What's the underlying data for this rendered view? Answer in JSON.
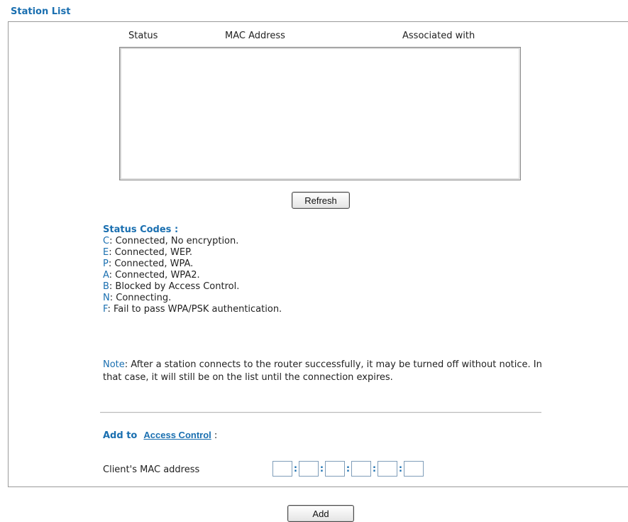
{
  "title": "Station List",
  "table": {
    "headers": [
      "Status",
      "MAC Address",
      "Associated with"
    ],
    "rows": []
  },
  "refresh_label": "Refresh",
  "status_codes": {
    "title": "Status Codes :",
    "items": [
      {
        "code": "C",
        "text": ": Connected, No encryption."
      },
      {
        "code": "E",
        "text": ": Connected, WEP."
      },
      {
        "code": "P",
        "text": ": Connected, WPA."
      },
      {
        "code": "A",
        "text": ": Connected, WPA2."
      },
      {
        "code": "B",
        "text": ": Blocked by Access Control."
      },
      {
        "code": "N",
        "text": ": Connecting."
      },
      {
        "code": "F",
        "text": ": Fail to pass WPA/PSK authentication."
      }
    ]
  },
  "note": {
    "label": "Note",
    "text": ": After a station connects to the router successfully, it may be turned off without notice. In that case, it will still be on the list until the connection expires."
  },
  "add_to": {
    "prefix": "Add to",
    "link": "Access Control",
    "suffix": " :"
  },
  "mac": {
    "label": "Client's MAC address",
    "separator": ":",
    "values": [
      "",
      "",
      "",
      "",
      "",
      ""
    ]
  },
  "add_label": "Add",
  "colors": {
    "accent": "#1a6fb0",
    "border": "#9a9a9a"
  }
}
